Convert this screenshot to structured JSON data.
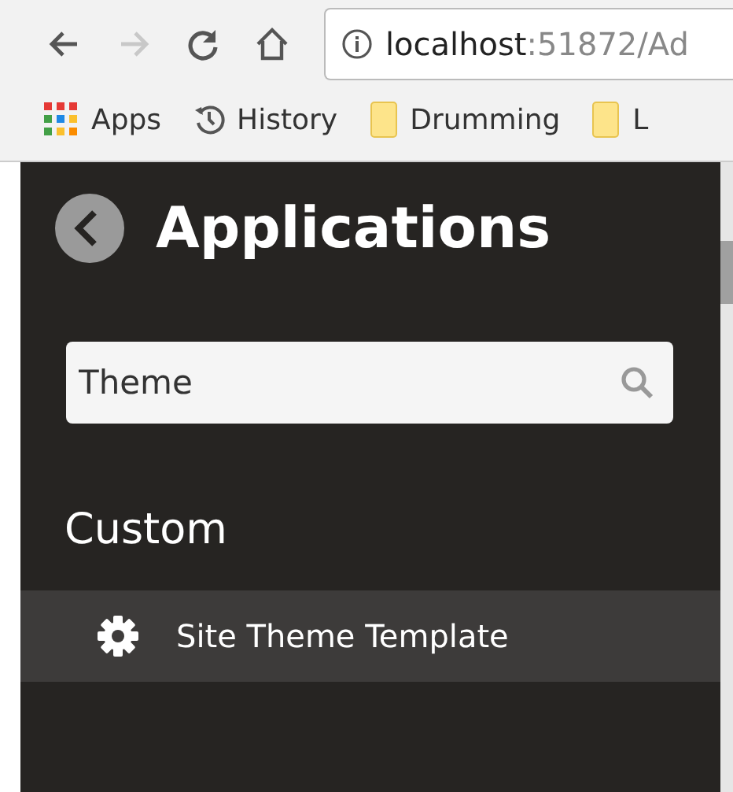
{
  "browser": {
    "nav_buttons": [
      {
        "kind": "back",
        "disabled": false
      },
      {
        "kind": "forward",
        "disabled": true
      },
      {
        "kind": "reload",
        "disabled": false
      },
      {
        "kind": "home",
        "disabled": false
      }
    ],
    "address": {
      "host": "localhost",
      "rest": ":51872/Ad"
    },
    "bookmarks": [
      {
        "kind": "apps",
        "label": "Apps"
      },
      {
        "kind": "history",
        "label": "History"
      },
      {
        "kind": "folder",
        "label": "Drumming"
      },
      {
        "kind": "folder",
        "label": "L"
      }
    ]
  },
  "panel": {
    "title": "Applications",
    "search": {
      "value": "Theme"
    },
    "sections": [
      {
        "heading": "Custom",
        "items": [
          {
            "label": "Site Theme Template",
            "selected": true
          }
        ]
      }
    ]
  }
}
